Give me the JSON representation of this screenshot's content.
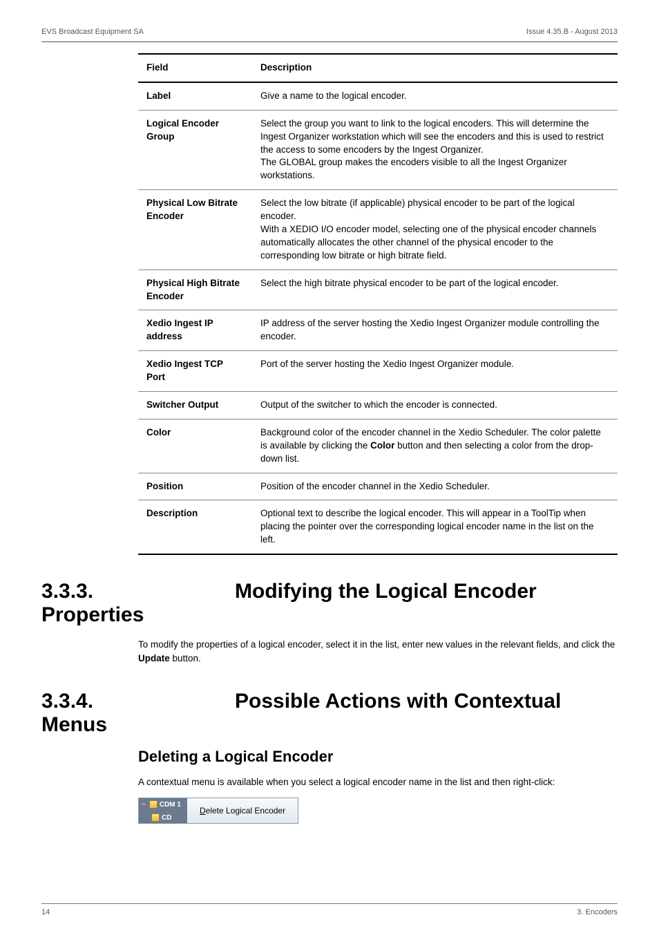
{
  "header": {
    "left": "EVS Broadcast Equipment SA",
    "right": "Issue 4.35.B - August 2013"
  },
  "table": {
    "head": [
      "Field",
      "Description"
    ],
    "rows": [
      {
        "field": "Label",
        "desc": "Give a name to the logical encoder."
      },
      {
        "field": "Logical Encoder Group",
        "desc": "Select the group you want to link to the logical encoders. This will determine the Ingest Organizer workstation which will see the encoders and this is used to restrict the access to some encoders by the Ingest Organizer.\nThe GLOBAL group makes the encoders visible to all the Ingest Organizer workstations."
      },
      {
        "field": "Physical Low Bitrate Encoder",
        "desc": "Select the low bitrate (if applicable) physical encoder to be part of the logical encoder.\nWith a XEDIO I/O encoder model, selecting one of the physical encoder channels automatically allocates the  other channel of the physical encoder to the corresponding low bitrate or high bitrate field."
      },
      {
        "field": "Physical High Bitrate Encoder",
        "desc": "Select the high bitrate physical encoder to be part of the logical encoder."
      },
      {
        "field": "Xedio Ingest IP address",
        "desc": "IP address of the server hosting the Xedio Ingest Organizer module controlling the encoder."
      },
      {
        "field": "Xedio Ingest TCP Port",
        "desc": "Port of the server hosting the Xedio Ingest Organizer module."
      },
      {
        "field": "Switcher Output",
        "desc": "Output of the switcher to which the encoder is connected."
      },
      {
        "field": "Color",
        "desc": "Background color of the encoder channel in the Xedio Scheduler. The color palette is available by clicking the Color button and then selecting a color from the drop-down list.",
        "bold_word": "Color"
      },
      {
        "field": "Position",
        "desc": "Position of the encoder channel in the Xedio Scheduler."
      },
      {
        "field": "Description",
        "desc": "Optional text to describe the logical encoder. This will appear in a ToolTip when placing the pointer over the corresponding logical encoder name in the list on the left."
      }
    ]
  },
  "sections": {
    "s333": {
      "num": "3.3.3.",
      "title": "Modifying the Logical Encoder Properties",
      "para": "To modify the properties of a logical encoder, select it in the list, enter new values in the relevant fields, and click the Update button.",
      "bold_word": "Update"
    },
    "s334": {
      "num": "3.3.4.",
      "title": "Possible Actions with Contextual Menus"
    }
  },
  "subsection": {
    "title": "Deleting a Logical Encoder",
    "para": "A contextual menu is available when you select a logical encoder name in the list and then right-click:"
  },
  "ctx_menu": {
    "left1": "CDM 1",
    "left2": "CD",
    "item_ukey": "D",
    "item_rest": "elete Logical Encoder"
  },
  "footer": {
    "left": "14",
    "right": "3. Encoders"
  }
}
